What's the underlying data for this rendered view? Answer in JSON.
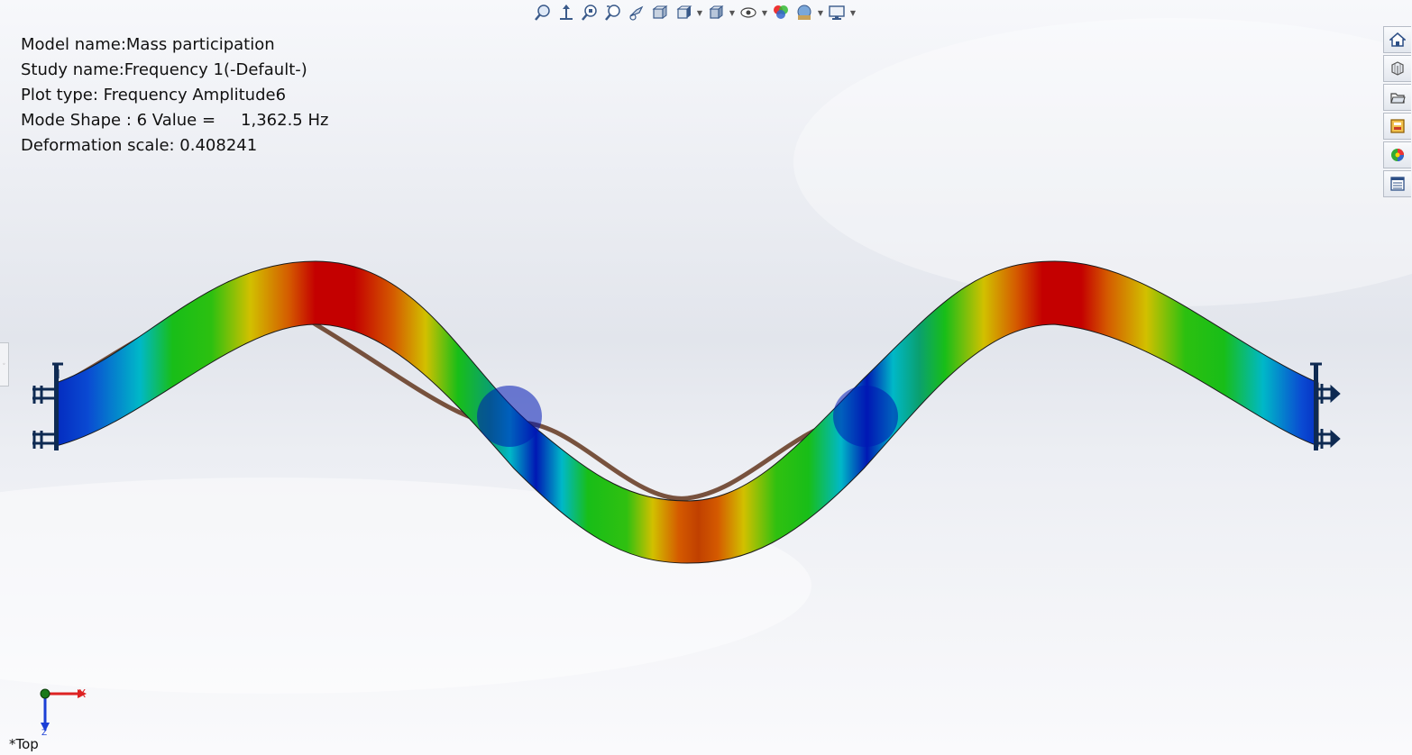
{
  "info": {
    "model_name": "Model name:Mass participation",
    "study_name": "Study name:Frequency 1(-Default-)",
    "plot_type": "Plot type: Frequency Amplitude6",
    "mode_shape": "Mode Shape : 6  Value =",
    "mode_value": "1,362.5 Hz",
    "deformation_scale": "Deformation scale: 0.408241"
  },
  "triad": {
    "x_label": "X",
    "z_label": "Z"
  },
  "view_name": "*Top",
  "toolbar_icons": [
    "zoom-to-fit-icon",
    "pan-icon",
    "zoom-area-icon",
    "zoom-in-out-icon",
    "rotate-icon",
    "section-view-icon",
    "view-orientation-icon",
    "display-style-icon",
    "hide-show-icon",
    "edit-appearance-icon",
    "apply-scene-icon",
    "view-settings-icon"
  ],
  "taskpane_icons": [
    "home-icon",
    "resources-icon",
    "design-library-icon",
    "file-explorer-icon",
    "appearances-icon",
    "custom-properties-icon"
  ],
  "colors": {
    "red": "#c40000",
    "orange": "#d45a00",
    "yellow": "#d2c000",
    "green": "#18be18",
    "cyan": "#00b8c8",
    "blue": "#0018b4",
    "fixture": "#0e2a52"
  }
}
